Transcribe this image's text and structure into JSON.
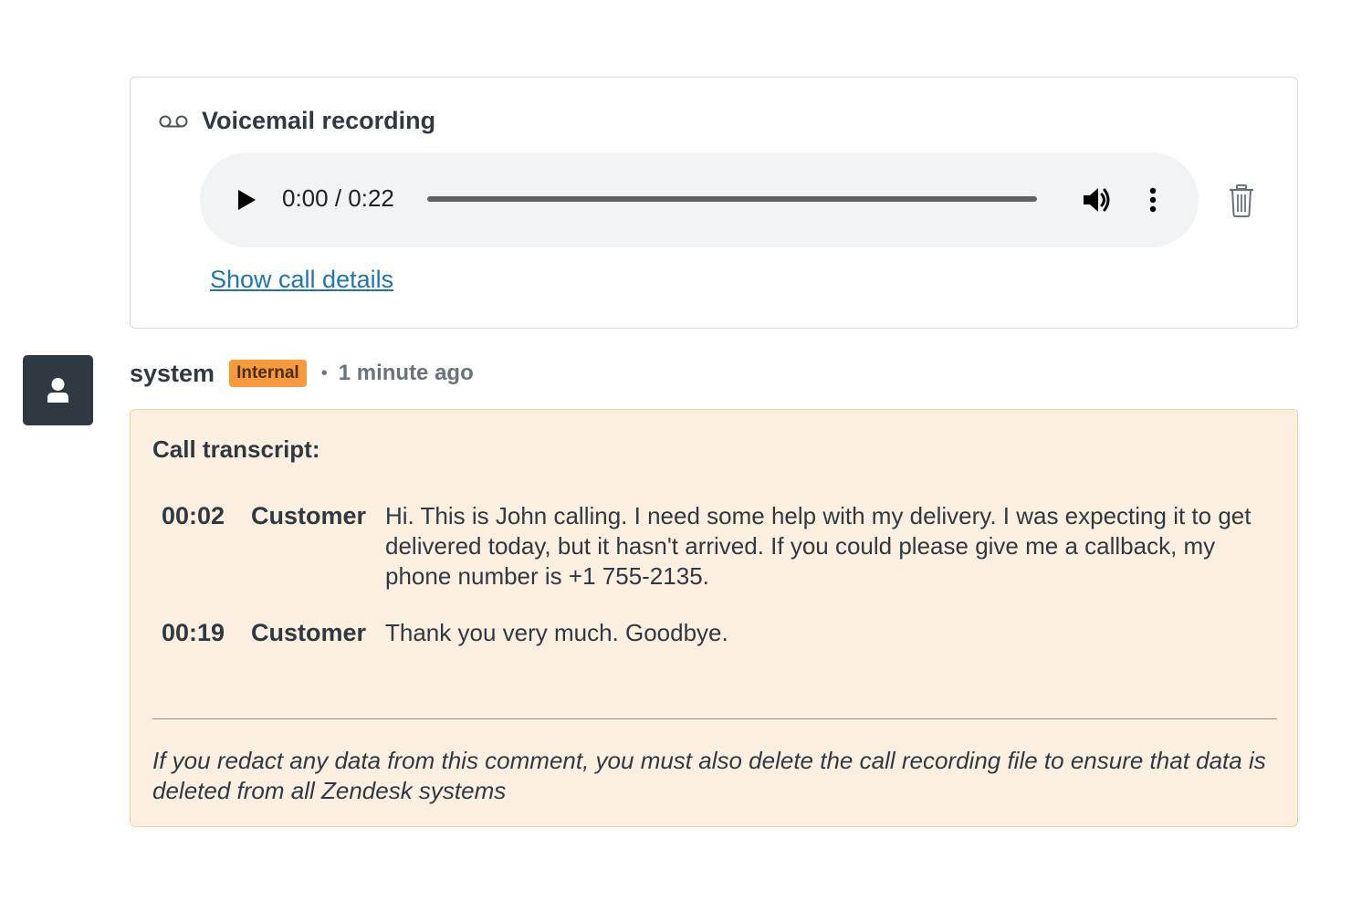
{
  "voicemail": {
    "title": "Voicemail recording",
    "icon": "voicemail-icon",
    "player": {
      "current_time": "0:00",
      "duration": "0:22",
      "time_display": "0:00 / 0:22",
      "progress_fraction": 0,
      "play_icon": "play-icon",
      "volume_icon": "volume-icon",
      "more_icon": "more-options-icon"
    },
    "delete_icon": "trash-icon",
    "details_link": "Show call details"
  },
  "comment": {
    "author": "system",
    "badge": "Internal",
    "separator": "•",
    "timestamp": "1 minute ago",
    "avatar_icon": "user-icon",
    "heading": "Call transcript:",
    "transcript": [
      {
        "time": "00:02",
        "speaker": "Customer",
        "text": "Hi. This is John calling. I need some help with my delivery. I was expecting it to get delivered today, but it hasn't arrived. If you could please give me a callback, my phone number is +1 755-2135."
      },
      {
        "time": "00:19",
        "speaker": "Customer",
        "text": "Thank you very much. Goodbye."
      }
    ],
    "footer": "If you redact any data from this comment, you must also delete the call recording file to ensure that data is deleted from all Zendesk systems"
  },
  "colors": {
    "link": "#1f73b7",
    "badge_bg": "#f79a3e",
    "note_bg": "#fef0e1",
    "note_border": "#fbcf9f",
    "avatar_bg": "#2f3941"
  }
}
